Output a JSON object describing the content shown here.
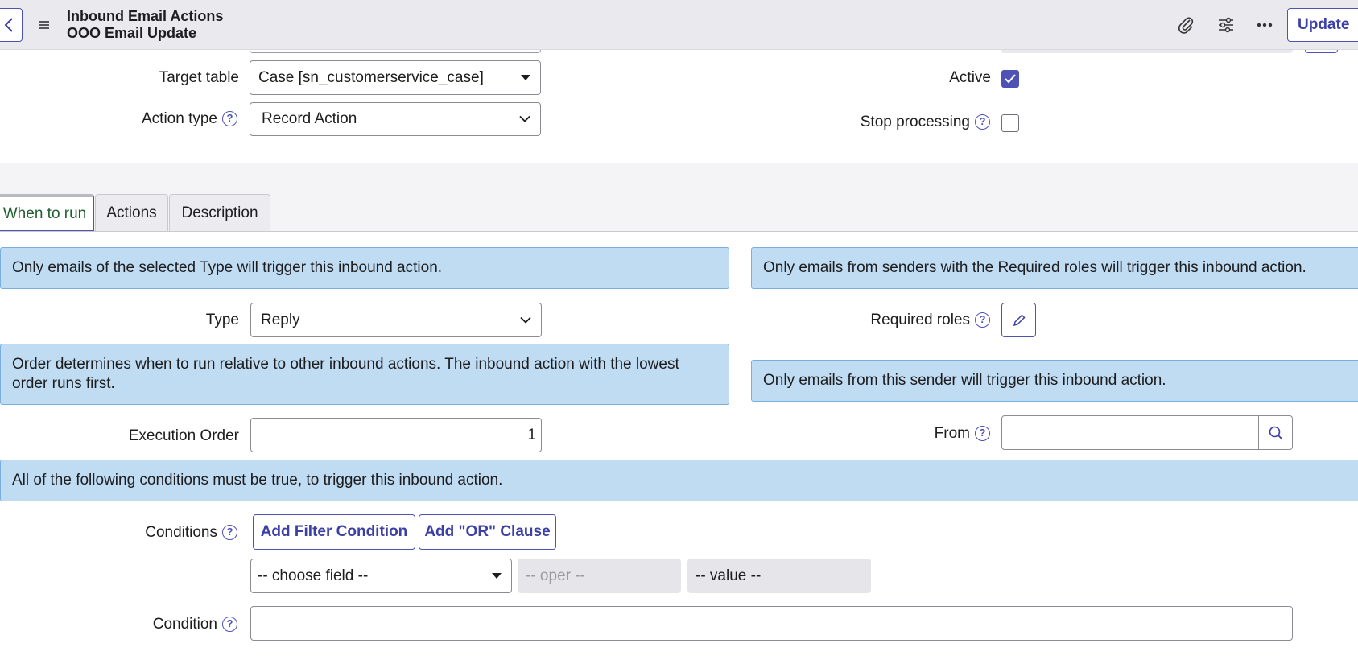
{
  "header": {
    "title": "Inbound Email Actions",
    "subtitle": "OOO Email Update",
    "update_label": "Update",
    "icons": [
      "back-icon",
      "hamburger-menu-icon",
      "paperclip-icon",
      "settings-sliders-icon",
      "more-options-icon"
    ]
  },
  "form": {
    "target_table": {
      "label": "Target table",
      "value": "Case [sn_customerservice_case]"
    },
    "action_type": {
      "label": "Action type",
      "value": "Record Action"
    },
    "active": {
      "label": "Active",
      "checked": true
    },
    "stop_processing": {
      "label": "Stop processing",
      "checked": false
    }
  },
  "tabs": [
    {
      "label": "When to run",
      "active": true
    },
    {
      "label": "Actions",
      "active": false
    },
    {
      "label": "Description",
      "active": false
    }
  ],
  "when_to_run": {
    "type_info": "Only emails of the selected Type will trigger this inbound action.",
    "roles_info": "Only emails from senders with the Required roles will trigger this inbound action.",
    "type": {
      "label": "Type",
      "value": "Reply"
    },
    "required_roles": {
      "label": "Required roles"
    },
    "order_info": "Order determines when to run relative to other inbound actions. The inbound action with the lowest order runs first.",
    "sender_info": "Only emails from this sender will trigger this inbound action.",
    "execution_order": {
      "label": "Execution Order",
      "value": "1"
    },
    "from": {
      "label": "From",
      "value": ""
    },
    "conditions_info": "All of the following conditions must be true, to trigger this inbound action.",
    "conditions": {
      "label": "Conditions",
      "add_filter_label": "Add Filter Condition",
      "add_or_label": "Add \"OR\" Clause",
      "field_placeholder": "-- choose field --",
      "oper_placeholder": "-- oper --",
      "value_placeholder": "-- value --"
    },
    "condition": {
      "label": "Condition",
      "value": ""
    }
  },
  "colors": {
    "accent": "#4e52b5",
    "info_background": "#bfdcf2",
    "header_background": "#e9e9ee"
  }
}
